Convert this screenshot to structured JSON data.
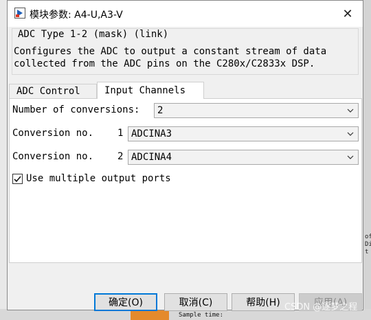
{
  "window": {
    "title": "模块参数: A4-U,A3-V",
    "close_glyph": "✕"
  },
  "mask": {
    "title": "ADC Type 1-2 (mask) (link)",
    "description_line1": "Configures the ADC to output a constant stream of data",
    "description_line2": "collected from the ADC pins on the C280x/C2833x DSP."
  },
  "tabs": [
    {
      "label": "ADC Control",
      "active": false
    },
    {
      "label": "Input Channels",
      "active": true
    }
  ],
  "panel": {
    "num_conversions_label": "Number of conversions:",
    "num_conversions_value": "2",
    "conversions": [
      {
        "label": "Conversion no.",
        "index": "1",
        "value": "ADCINA3"
      },
      {
        "label": "Conversion no.",
        "index": "2",
        "value": "ADCINA4"
      }
    ],
    "multi_output": {
      "label": "Use multiple output ports",
      "checked": true
    }
  },
  "buttons": {
    "ok": "确定(O)",
    "cancel": "取消(C)",
    "help": "帮助(H)",
    "apply": "应用(A)"
  },
  "background": {
    "sample_time_text": "Sample time:",
    "right_edge_text": "of\nDi\nt"
  },
  "watermark": "CSDN @逐梦之程",
  "colors": {
    "focus_border": "#0078d7",
    "disabled_text": "#8a8a8a",
    "orange_block": "#e48a2c"
  }
}
